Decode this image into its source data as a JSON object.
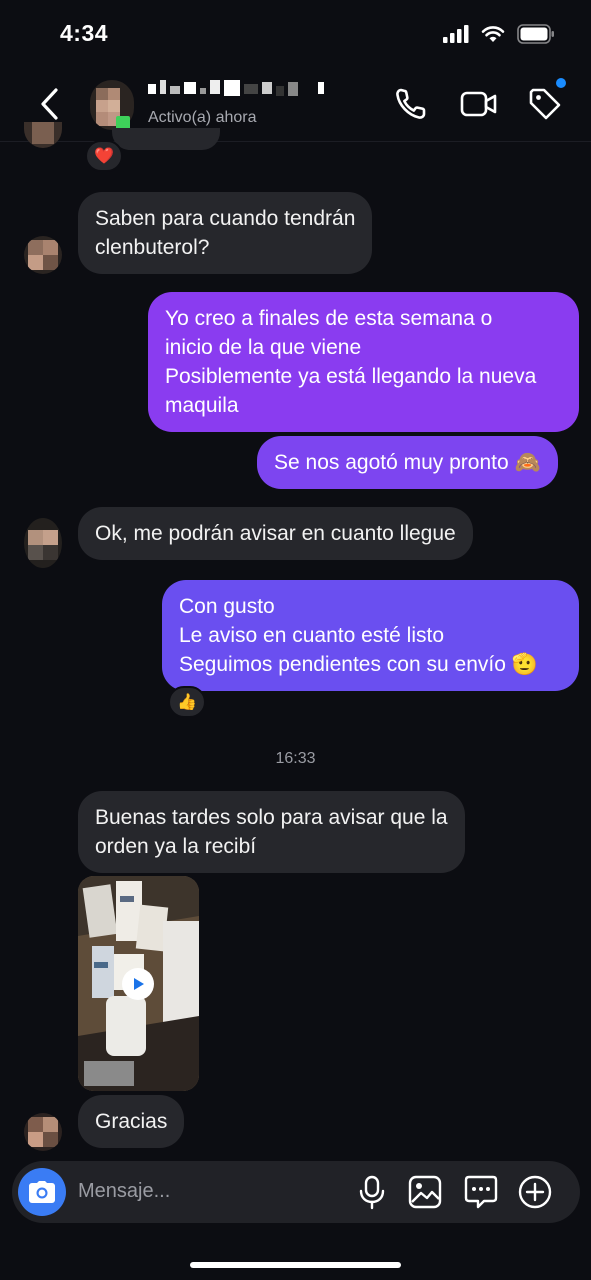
{
  "status_bar": {
    "time": "4:34"
  },
  "header": {
    "contact_status": "Activo(a) ahora",
    "icons": [
      "back-icon",
      "phone-icon",
      "video-call-icon",
      "tag-icon"
    ],
    "accent_color": "#1a8cff"
  },
  "messages": [
    {
      "from": "them",
      "lines": [
        "Saben para cuando tendrán",
        "clenbuterol?"
      ]
    },
    {
      "from": "me",
      "lines": [
        "Yo creo a finales de esta semana o",
        "inicio de la que viene",
        "Posiblemente ya está llegando la nueva",
        "maquila"
      ]
    },
    {
      "from": "me",
      "lines": [
        "Se nos agotó muy pronto 🙈"
      ]
    },
    {
      "from": "them",
      "lines": [
        "Ok, me podrán avisar en cuanto llegue"
      ]
    },
    {
      "from": "me",
      "lines": [
        "Con gusto",
        "Le aviso en cuanto esté listo",
        "Seguimos pendientes con su envío 🫡"
      ]
    },
    {
      "from": "them",
      "lines": [
        "Buenas tardes solo para avisar que la",
        "orden ya la recibí"
      ]
    },
    {
      "from": "them",
      "lines": [
        "Gracias"
      ]
    }
  ],
  "reactions": {
    "top": "❤️",
    "con_gusto": "👍"
  },
  "timestamp": "16:33",
  "composer": {
    "placeholder": "Mensaje..."
  },
  "colors": {
    "background": "#0c0d12",
    "incoming_bubble": "#26272c",
    "outgoing_top": "#8a3cf0",
    "outgoing_bottom": "#6a4ff0",
    "camera_button": "#3a7cf4"
  }
}
